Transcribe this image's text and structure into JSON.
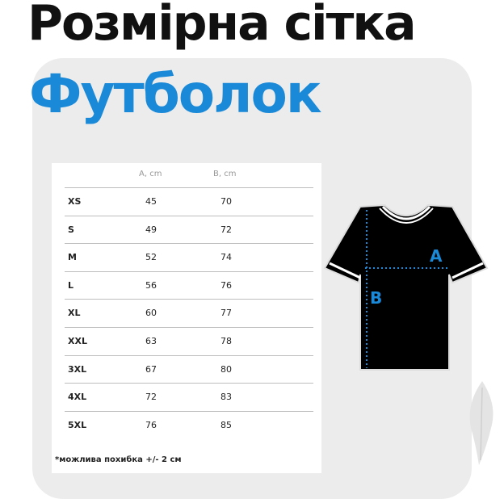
{
  "header": {
    "title_line1": "Розмірна сітка",
    "title_line2": "Футболок"
  },
  "table": {
    "columns": [
      "A, cm",
      "B, cm"
    ],
    "rows": [
      {
        "size": "XS",
        "a": "45",
        "b": "70"
      },
      {
        "size": "S",
        "a": "49",
        "b": "72"
      },
      {
        "size": "M",
        "a": "52",
        "b": "74"
      },
      {
        "size": "L",
        "a": "56",
        "b": "76"
      },
      {
        "size": "XL",
        "a": "60",
        "b": "77"
      },
      {
        "size": "XXL",
        "a": "63",
        "b": "78"
      },
      {
        "size": "3XL",
        "a": "67",
        "b": "80"
      },
      {
        "size": "4XL",
        "a": "72",
        "b": "83"
      },
      {
        "size": "5XL",
        "a": "76",
        "b": "85"
      }
    ],
    "note": "*можлива похибка +/- 2 см"
  },
  "diagram": {
    "label_a": "A",
    "label_b": "B"
  },
  "colors": {
    "accent": "#1a8ad8",
    "title": "#111111",
    "panel": "#ececec"
  }
}
